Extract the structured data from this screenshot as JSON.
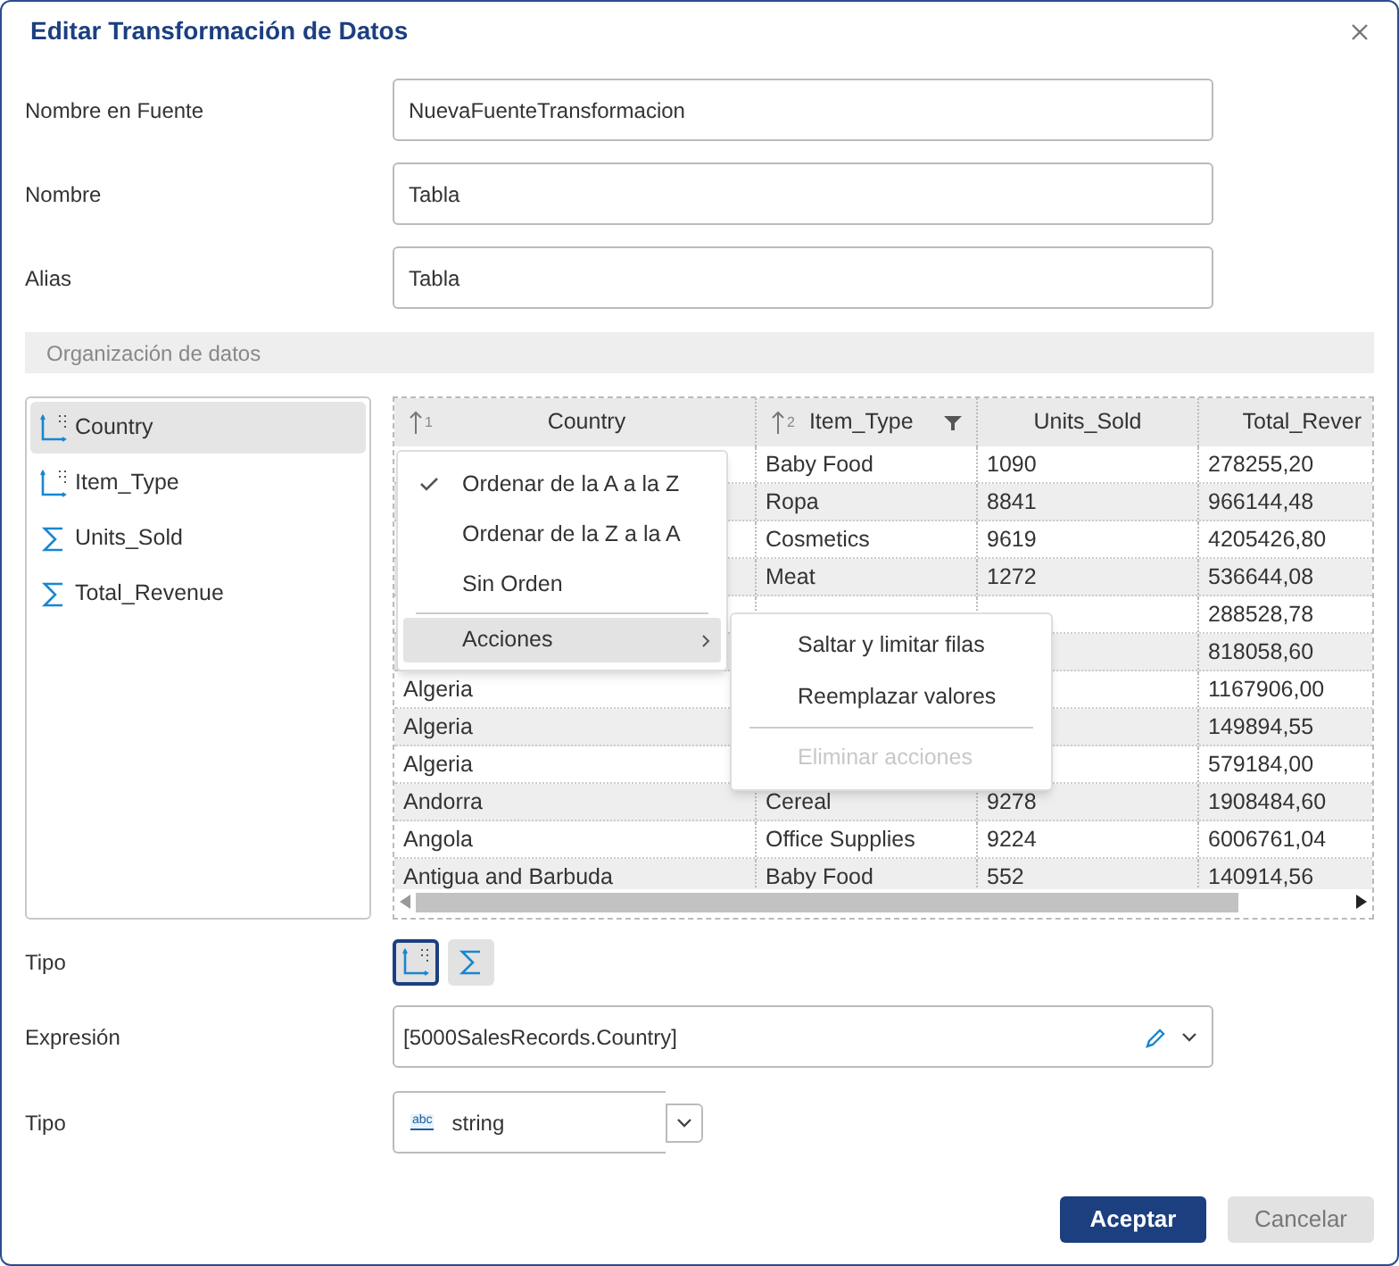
{
  "window": {
    "title": "Editar Transformación de Datos"
  },
  "form": [
    {
      "label": "Nombre en Fuente",
      "value": "NuevaFuenteTransformacion"
    },
    {
      "label": "Nombre",
      "value": "Tabla"
    },
    {
      "label": "Alias",
      "value": "Tabla"
    }
  ],
  "section": {
    "title": "Organización de datos"
  },
  "fields": [
    {
      "name": "Country",
      "kind": "dimension",
      "selected": true
    },
    {
      "name": "Item_Type",
      "kind": "dimension",
      "selected": false
    },
    {
      "name": "Units_Sold",
      "kind": "measure",
      "selected": false
    },
    {
      "name": "Total_Revenue",
      "kind": "measure",
      "selected": false
    }
  ],
  "table": {
    "columns": [
      {
        "label": "Country",
        "sort_order": "1",
        "filtered": false
      },
      {
        "label": "Item_Type",
        "sort_order": "2",
        "filtered": true
      },
      {
        "label": "Units_Sold",
        "filtered": false
      },
      {
        "label": "Total_Rever",
        "filtered": false
      }
    ],
    "rows": [
      [
        null,
        "Baby Food",
        "1090",
        "278255,20"
      ],
      [
        null,
        "Ropa",
        "8841",
        "966144,48"
      ],
      [
        null,
        "Cosmetics",
        "9619",
        "4205426,80"
      ],
      [
        null,
        "Meat",
        "1272",
        "536644,08"
      ],
      [
        null,
        null,
        null,
        "288528,78"
      ],
      [
        null,
        null,
        null,
        "818058,60"
      ],
      [
        "Algeria",
        null,
        null,
        "1167906,00"
      ],
      [
        "Algeria",
        null,
        null,
        "149894,55"
      ],
      [
        "Algeria",
        null,
        null,
        "579184,00"
      ],
      [
        "Andorra",
        "Cereal",
        "9278",
        "1908484,60"
      ],
      [
        "Angola",
        "Office Supplies",
        "9224",
        "6006761,04"
      ],
      [
        "Antigua and Barbuda",
        "Baby Food",
        "552",
        "140914,56"
      ]
    ]
  },
  "context_menu": {
    "items": [
      {
        "label": "Ordenar de la A a la Z",
        "checked": true,
        "kind": "option"
      },
      {
        "label": "Ordenar de la Z a la A",
        "checked": false,
        "kind": "option"
      },
      {
        "label": "Sin Orden",
        "checked": false,
        "kind": "option"
      },
      {
        "kind": "separator"
      },
      {
        "label": "Acciones",
        "kind": "submenu",
        "selected": true
      }
    ],
    "submenu": [
      {
        "label": "Saltar y limitar filas",
        "disabled": false,
        "kind": "option"
      },
      {
        "label": "Reemplazar valores",
        "disabled": false,
        "kind": "option"
      },
      {
        "kind": "separator"
      },
      {
        "label": "Eliminar acciones",
        "disabled": true,
        "kind": "option"
      }
    ]
  },
  "type_row": {
    "label": "Tipo",
    "options": [
      {
        "kind": "dimension",
        "selected": true
      },
      {
        "kind": "measure",
        "selected": false
      }
    ]
  },
  "expression": {
    "label": "Expresión",
    "value": "[5000SalesRecords.Country]"
  },
  "data_type": {
    "label": "Tipo",
    "badge": "abc",
    "value": "string"
  },
  "buttons": [
    {
      "label": "Aceptar",
      "kind": "primary"
    },
    {
      "label": "Cancelar",
      "kind": "secondary"
    }
  ]
}
